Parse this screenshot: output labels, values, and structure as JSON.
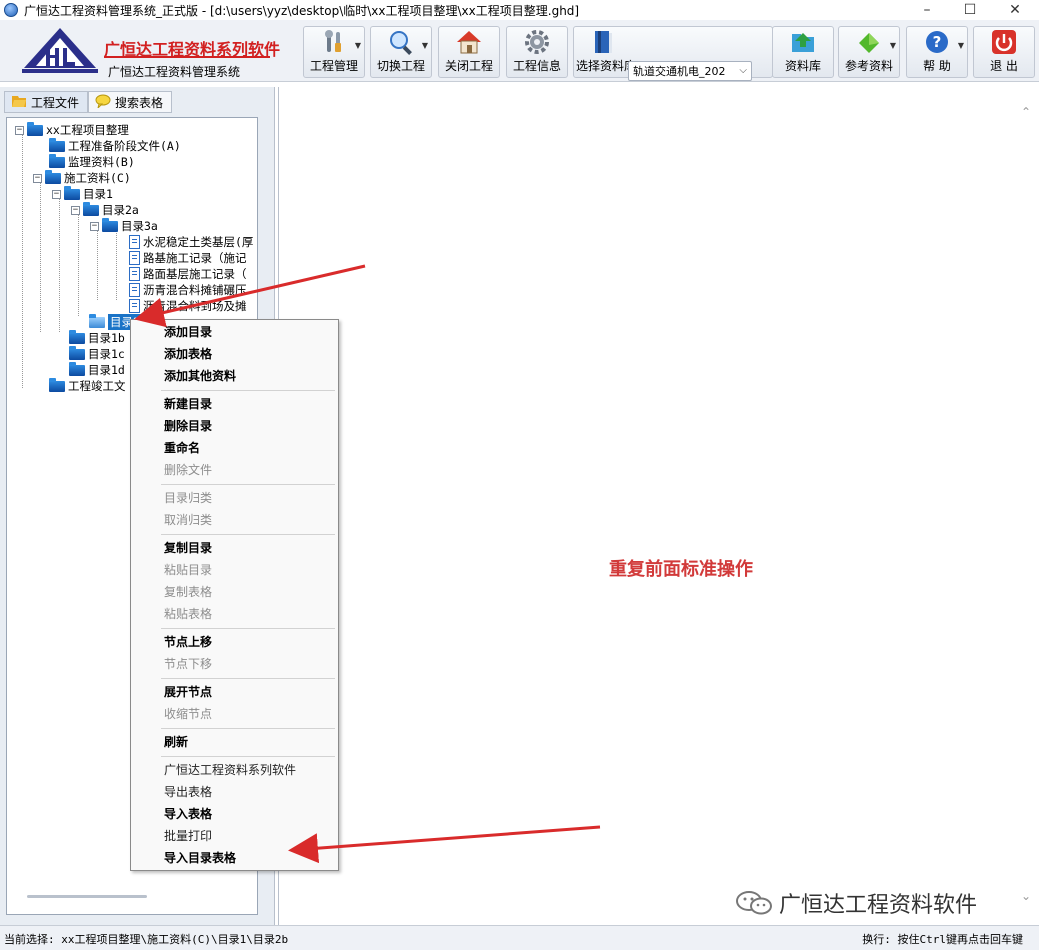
{
  "window": {
    "title": "广恒达工程资料管理系统_正式版 - [d:\\users\\yyz\\desktop\\临时\\xx工程项目整理\\xx工程项目整理.ghd]",
    "minimize": "–",
    "maximize": "☐",
    "close": "✕"
  },
  "brand": {
    "title": "广恒达工程资料系列软件",
    "subtitle": "广恒达工程资料管理系统"
  },
  "toolbar": {
    "project_manage": "工程管理",
    "switch_project": "切换工程",
    "close_project": "关闭工程",
    "project_info": "工程信息",
    "select_library": "选择资料库",
    "library_value": "轨道交通机电_202",
    "library": "资料库",
    "reference": "参考资料",
    "help": "帮 助",
    "exit": "退 出"
  },
  "tabs": {
    "project_files": "工程文件",
    "search_tables": "搜索表格"
  },
  "tree": {
    "root": "xx工程项目整理",
    "prep": "工程准备阶段文件(A)",
    "supervision": "监理资料(B)",
    "construction": "施工资料(C)",
    "dir1": "目录1",
    "dir2a": "目录2a",
    "dir3a": "目录3a",
    "file1": "水泥稳定土类基层(厚",
    "file2": "路基施工记录（施记",
    "file3": "路面基层施工记录（",
    "file4": "沥青混合料摊铺碾压",
    "file5": "沥青混合料到场及摊",
    "dir2b": "目录2",
    "dir1b": "目录1b",
    "dir1c": "目录1c",
    "dir1d": "目录1d",
    "completion": "工程竣工文"
  },
  "menu": {
    "add_dir": "添加目录",
    "add_table": "添加表格",
    "add_other": "添加其他资料",
    "new_dir": "新建目录",
    "delete_dir": "删除目录",
    "rename": "重命名",
    "delete_file": "删除文件",
    "dir_classify": "目录归类",
    "cancel_classify": "取消归类",
    "copy_dir": "复制目录",
    "paste_dir": "粘贴目录",
    "copy_table": "复制表格",
    "paste_table": "粘贴表格",
    "node_up": "节点上移",
    "node_down": "节点下移",
    "expand_node": "展开节点",
    "collapse_node": "收缩节点",
    "refresh": "刷新",
    "series": "广恒达工程资料系列软件",
    "export_table": "导出表格",
    "import_table": "导入表格",
    "batch_print": "批量打印",
    "import_dir_table": "导入目录表格"
  },
  "main": {
    "note": "重复前面标准操作",
    "watermark": "广恒达工程资料软件"
  },
  "status": {
    "current": "当前选择: xx工程项目整理\\施工资料(C)\\目录1\\目录2b",
    "hint": "换行: 按住Ctrl键再点击回车键"
  },
  "colors": {
    "brand_red": "#d22020",
    "note_red": "#d23a3a",
    "selection_blue": "#1a73c7",
    "folder_blue": "#0c4aa0"
  }
}
